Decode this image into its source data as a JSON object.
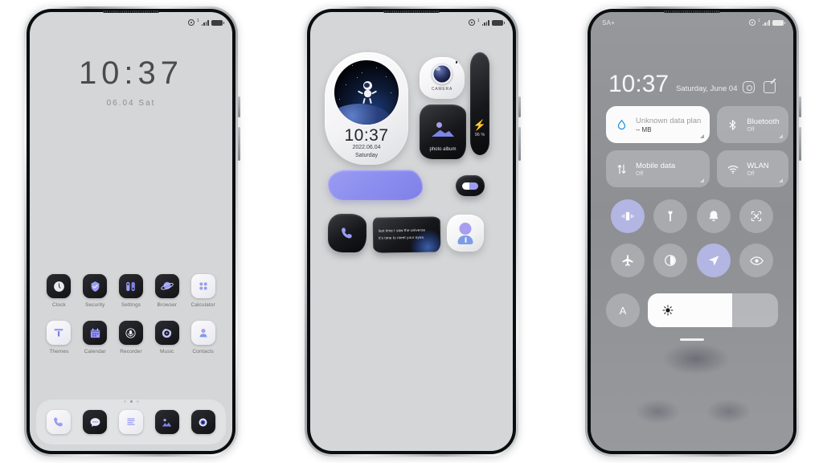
{
  "phone1": {
    "name": "home-screen",
    "statusbar": {
      "signal_icon": "signal-bars-icon",
      "battery_icon": "battery-icon",
      "location_icon": "location-circle-icon"
    },
    "clock": {
      "time": "10:37",
      "date": "06.04  Sat"
    },
    "apps": [
      {
        "label": "Clock",
        "icon": "clock-icon",
        "style": "dark"
      },
      {
        "label": "Security",
        "icon": "shield-icon",
        "style": "dark"
      },
      {
        "label": "Settings",
        "icon": "sliders-icon",
        "style": "dark"
      },
      {
        "label": "Browser",
        "icon": "planet-icon",
        "style": "dark"
      },
      {
        "label": "Calculator",
        "icon": "calculator-icon",
        "style": "light"
      },
      {
        "label": "Themes",
        "icon": "themes-icon",
        "style": "light"
      },
      {
        "label": "Calendar",
        "icon": "calendar-icon",
        "style": "dark"
      },
      {
        "label": "Recorder",
        "icon": "microphone-icon",
        "style": "dark"
      },
      {
        "label": "Music",
        "icon": "music-disc-icon",
        "style": "dark"
      },
      {
        "label": "Contacts",
        "icon": "contacts-icon",
        "style": "light"
      }
    ],
    "page_dots": {
      "count": 3,
      "active_index": 1
    },
    "dock": [
      {
        "icon": "phone-icon",
        "style": "light"
      },
      {
        "icon": "messages-icon",
        "style": "dark"
      },
      {
        "icon": "notes-icon",
        "style": "light"
      },
      {
        "icon": "gallery-icon",
        "style": "dark"
      },
      {
        "icon": "camera-icon",
        "style": "dark"
      }
    ]
  },
  "phone2": {
    "name": "widget-screen",
    "statusbar": {
      "signal_icon": "signal-bars-icon",
      "battery_icon": "battery-icon",
      "location_icon": "location-circle-icon"
    },
    "clock_widget": {
      "time": "10:37",
      "date": "2022.06.04",
      "weekday": "Saturday",
      "art": "astronaut-space-icon"
    },
    "camera_widget": {
      "label": "CAMERA",
      "icon": "camera-lens-icon"
    },
    "battery_widget": {
      "percent": "96 %",
      "icon": "lightning-bolt-icon"
    },
    "album_widget": {
      "label": "photo album",
      "icon": "picture-icon"
    },
    "blob_widget": {
      "name": "decorative-blob"
    },
    "toggle_widget": {
      "name": "switch-toggle",
      "state": "on"
    },
    "phone_widget": {
      "icon": "phone-icon"
    },
    "quote_widget": {
      "line1": "last time I saw the universe",
      "line2": "it's time to meet your eyes."
    },
    "contact_widget": {
      "icon": "person-icon"
    }
  },
  "phone3": {
    "name": "control-center",
    "statusbar": {
      "carrier": "SA+",
      "signal_icon": "signal-bars-icon",
      "battery_icon": "battery-icon",
      "location_icon": "location-circle-icon"
    },
    "time": "10:37",
    "date": "Saturday, June 04",
    "actions": [
      {
        "name": "settings-hex-button",
        "icon": "gear-hex-icon"
      },
      {
        "name": "edit-button",
        "icon": "edit-pencil-icon"
      }
    ],
    "tiles": [
      {
        "title": "Unknown data plan",
        "sub": "-- MB",
        "icon": "data-drop-icon",
        "active": true
      },
      {
        "title": "Bluetooth",
        "sub": "Off",
        "icon": "bluetooth-icon",
        "active": false
      },
      {
        "title": "Mobile data",
        "sub": "Off",
        "icon": "mobile-data-icon",
        "active": false
      },
      {
        "title": "WLAN",
        "sub": "Off",
        "icon": "wifi-icon",
        "active": false
      }
    ],
    "toggles": [
      {
        "name": "vibrate-toggle",
        "icon": "vibrate-icon",
        "on": true
      },
      {
        "name": "flashlight-toggle",
        "icon": "flashlight-icon",
        "on": false
      },
      {
        "name": "ringtone-toggle",
        "icon": "bell-icon",
        "on": false
      },
      {
        "name": "screenshot-toggle",
        "icon": "screenshot-icon",
        "on": false
      },
      {
        "name": "airplane-toggle",
        "icon": "airplane-icon",
        "on": false
      },
      {
        "name": "dark-mode-toggle",
        "icon": "contrast-icon",
        "on": false
      },
      {
        "name": "location-toggle",
        "icon": "navigation-arrow-icon",
        "on": true
      },
      {
        "name": "eye-care-toggle",
        "icon": "eye-icon",
        "on": false
      }
    ],
    "auto_brightness": {
      "label": "A"
    },
    "brightness": {
      "icon": "sun-icon",
      "percent": 65
    }
  },
  "colors": {
    "accent_purple": "#9a9cf2",
    "screen_grey": "#d5d6d7",
    "panel_grey": "#8e9093",
    "dark_icon": "#16171a"
  }
}
